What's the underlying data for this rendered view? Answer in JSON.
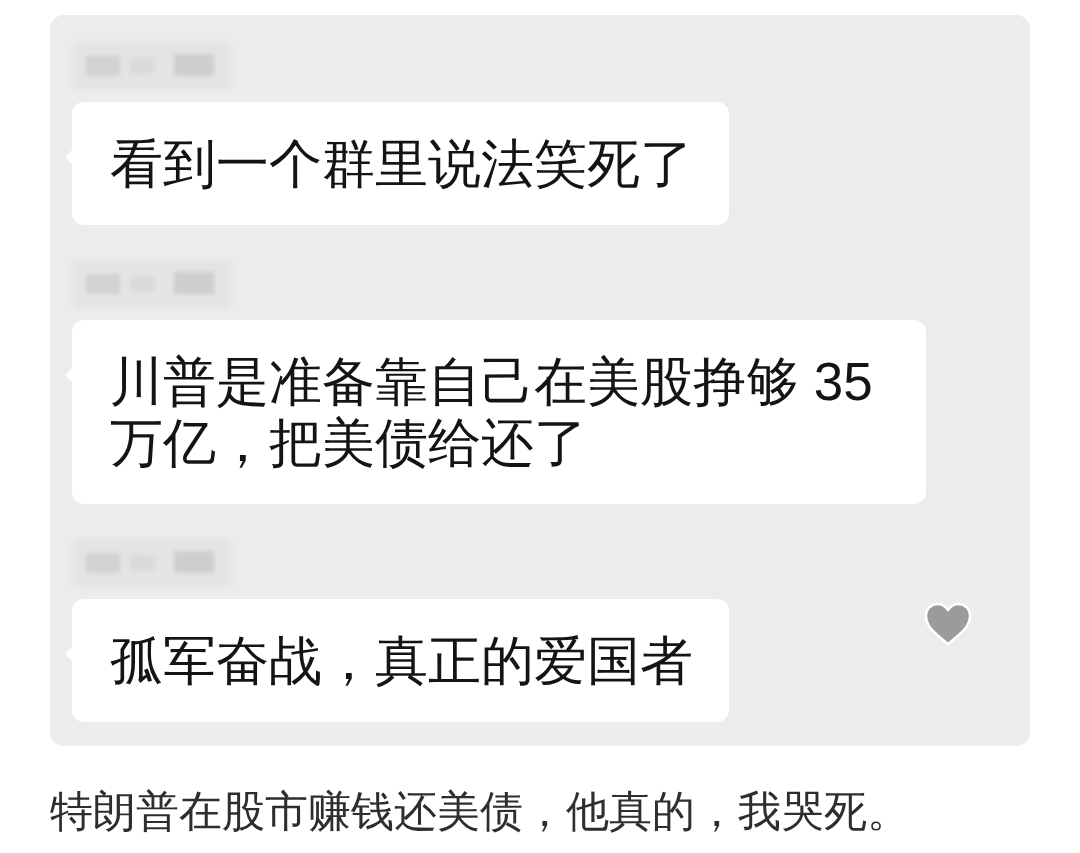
{
  "messages": [
    {
      "text": "看到一个群里说法笑死了",
      "liked": false
    },
    {
      "text": "川普是准备靠自己在美股挣够 35 万亿，把美债给还了",
      "liked": false
    },
    {
      "text": "孤军奋战，真正的爱国者",
      "liked": true
    }
  ],
  "caption": "特朗普在股市赚钱还美债，他真的，我哭死。"
}
